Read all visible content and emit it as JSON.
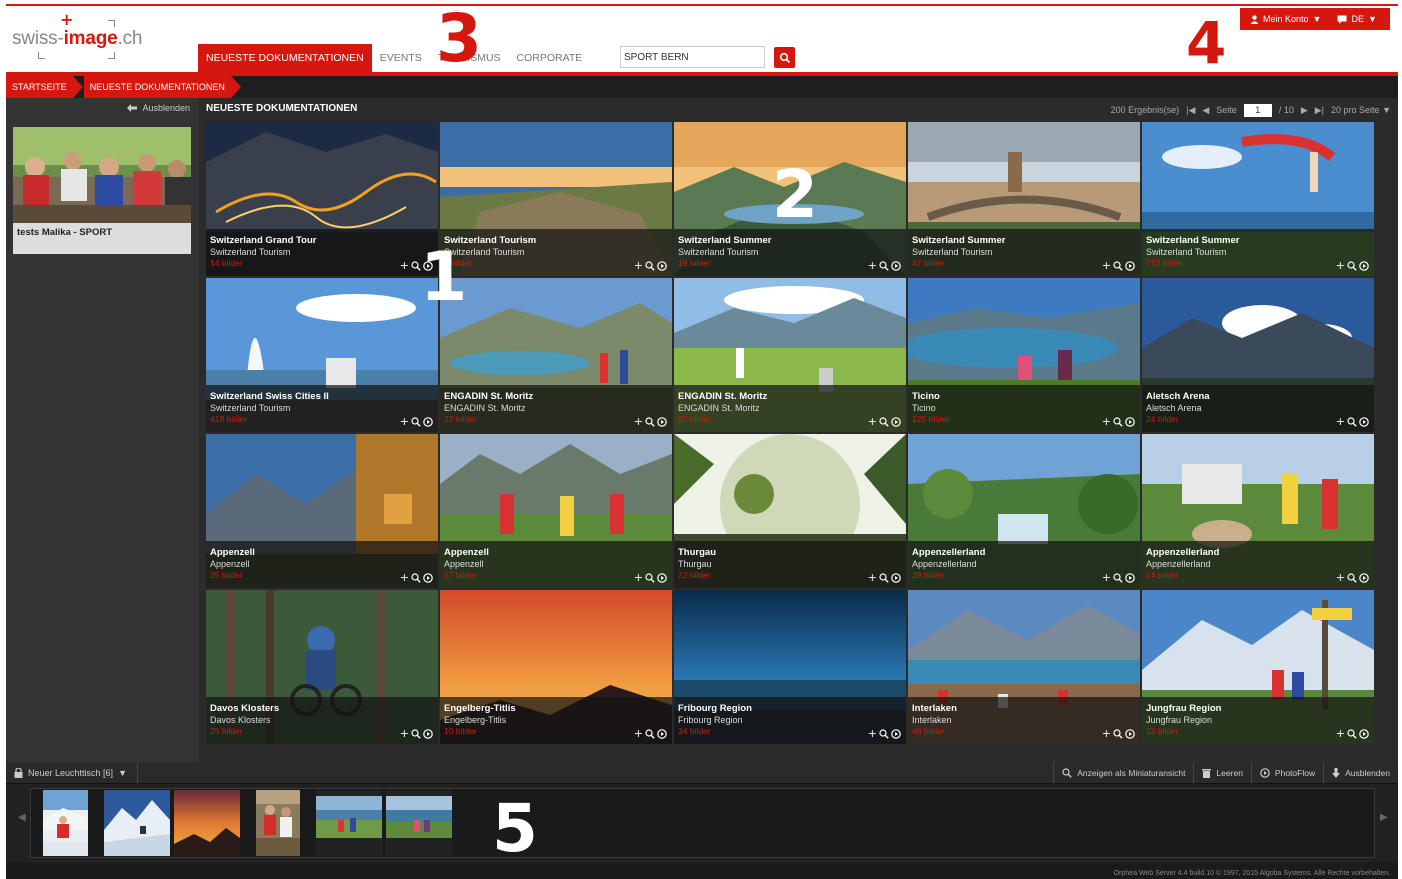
{
  "header": {
    "logo": {
      "prefix": "swiss-",
      "brand": "image",
      "suffix": ".ch"
    },
    "nav": [
      {
        "label": "NEUESTE DOKUMENTATIONEN",
        "active": true
      },
      {
        "label": "EVENTS",
        "active": false
      },
      {
        "label": "TOURISMUS",
        "active": false
      },
      {
        "label": "CORPORATE",
        "active": false
      }
    ],
    "search": {
      "value": "SPORT BERN"
    },
    "account": {
      "label": "Mein Konto",
      "lang": "DE"
    }
  },
  "breadcrumb": [
    "STARTSEITE",
    "NEUESTE DOKUMENTATIONEN"
  ],
  "sidebar": {
    "hide_label": "Ausblenden",
    "item_caption": "tests Malika - SPORT"
  },
  "content": {
    "title": "NEUESTE DOKUMENTATIONEN",
    "results": "200 Ergebnis(se)",
    "page_label": "Seite",
    "page_value": "1",
    "page_total": "/ 10",
    "per_page": "20 pro Seite"
  },
  "tiles": [
    {
      "title": "Switzerland Grand Tour",
      "subtitle": "Switzerland Tourism",
      "count": "14 bilder"
    },
    {
      "title": "Switzerland Tourism",
      "subtitle": "Switzerland Tourism",
      "count": "7 bilder"
    },
    {
      "title": "Switzerland Summer",
      "subtitle": "Switzerland Tourism",
      "count": "19 bilder"
    },
    {
      "title": "Switzerland Summer",
      "subtitle": "Switzerland Tourism",
      "count": "47 bilder"
    },
    {
      "title": "Switzerland Summer",
      "subtitle": "Switzerland Tourism",
      "count": "773 bilder"
    },
    {
      "title": "Switzerland Swiss Cities II",
      "subtitle": "Switzerland Tourism",
      "count": "419 bilder"
    },
    {
      "title": "ENGADIN St. Moritz",
      "subtitle": "ENGADIN St. Moritz",
      "count": "27 bilder"
    },
    {
      "title": "ENGADIN St. Moritz",
      "subtitle": "ENGADIN St. Moritz",
      "count": "55 bilder"
    },
    {
      "title": "Ticino",
      "subtitle": "Ticino",
      "count": "125 bilder"
    },
    {
      "title": "Aletsch Arena",
      "subtitle": "Aletsch Arena",
      "count": "24 bilder"
    },
    {
      "title": "Appenzell",
      "subtitle": "Appenzell",
      "count": "25 bilder"
    },
    {
      "title": "Appenzell",
      "subtitle": "Appenzell",
      "count": "17 bilder"
    },
    {
      "title": "Thurgau",
      "subtitle": "Thurgau",
      "count": "22 bilder"
    },
    {
      "title": "Appenzellerland",
      "subtitle": "Appenzellerland",
      "count": "28 bilder"
    },
    {
      "title": "Appenzellerland",
      "subtitle": "Appenzellerland",
      "count": "14 bilder"
    },
    {
      "title": "Davos Klosters",
      "subtitle": "Davos Klosters",
      "count": "25 bilder"
    },
    {
      "title": "Engelberg-Titlis",
      "subtitle": "Engelberg-Titlis",
      "count": "10 bilder"
    },
    {
      "title": "Fribourg Region",
      "subtitle": "Fribourg Region",
      "count": "34 bilder"
    },
    {
      "title": "Interlaken",
      "subtitle": "Interlaken",
      "count": "48 bilder"
    },
    {
      "title": "Jungfrau Region",
      "subtitle": "Jungfrau Region",
      "count": "22 bilder"
    }
  ],
  "lightbox": {
    "title": "Neuer Leuchttisch [6]",
    "actions": [
      "Anzeigen als Miniaturansicht",
      "Leeren",
      "PhotoFlow",
      "Ausblenden"
    ]
  },
  "footer": {
    "text": "Orphea Web Server 4.4 build 10 © 1997, 2015 Algoba Systems. Alle Rechte vorbehalten."
  },
  "annotations": [
    "1",
    "2",
    "3",
    "4",
    "5"
  ],
  "colors": {
    "accent": "#d6170f",
    "dark": "#2b2b2b"
  }
}
